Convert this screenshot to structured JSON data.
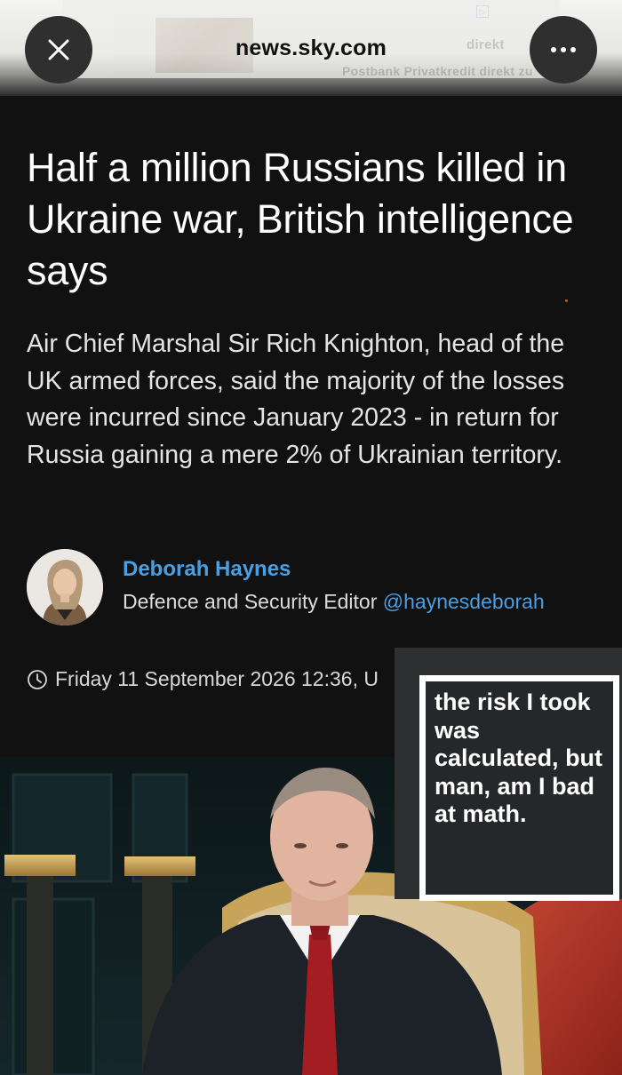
{
  "browser": {
    "url": "news.sky.com",
    "close_icon": "close-icon",
    "more_icon": "more-dots-icon",
    "ad": {
      "line1": "direkt",
      "line2": "Postbank Privatkredit direkt zu"
    }
  },
  "article": {
    "headline": "Half a million Russians killed in Ukraine war, British intelligence says",
    "standfirst": "Air Chief Marshal Sir Rich Knighton, head of the UK armed forces, said the majority of the losses were incurred since January 2023 - in return for Russia gaining a mere 2% of Ukrainian territory.",
    "author": {
      "name": "Deborah Haynes",
      "role": "Defence and Security Editor",
      "handle": "@haynesdeborah"
    },
    "timestamp": "Friday 11 September 2026 12:36, U"
  },
  "meme": {
    "text": "the risk I took was calculated, but man, am I bad at math."
  },
  "colors": {
    "background": "#111112",
    "link_blue": "#4a9fe2",
    "meme_bg": "#26272a"
  }
}
